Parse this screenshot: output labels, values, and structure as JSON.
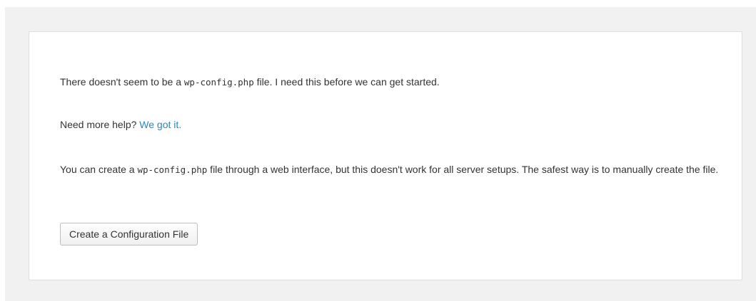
{
  "setup": {
    "message_before": "There doesn't seem to be a ",
    "config_filename": "wp-config.php",
    "message_after": " file. I need this before we can get started.",
    "help_prompt": "Need more help? ",
    "help_link_text": "We got it.",
    "info_before": "You can create a ",
    "info_filename": "wp-config.php",
    "info_after": " file through a web interface, but this doesn't work for all server setups. The safest way is to manually create the file.",
    "button_label": "Create a Configuration File"
  },
  "colors": {
    "link": "#2e86bd",
    "text": "#333333",
    "page_background": "#f1f1f1",
    "panel_background": "#ffffff"
  }
}
